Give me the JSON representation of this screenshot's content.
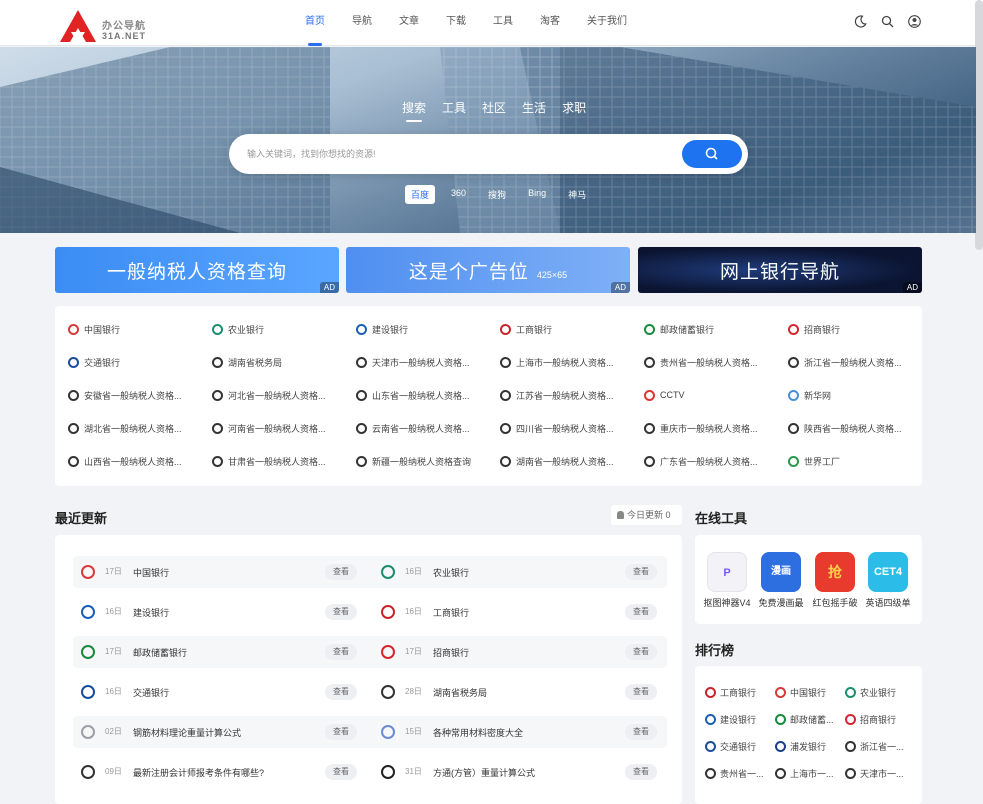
{
  "logo": {
    "name": "办公导航",
    "domain": "31A.NET"
  },
  "nav": {
    "items": [
      {
        "label": "首页",
        "active": true
      },
      {
        "label": "导航",
        "active": false
      },
      {
        "label": "文章",
        "active": false
      },
      {
        "label": "下载",
        "active": false
      },
      {
        "label": "工具",
        "active": false
      },
      {
        "label": "淘客",
        "active": false
      },
      {
        "label": "关于我们",
        "active": false
      }
    ],
    "icons": [
      "moon-icon",
      "search-icon",
      "user-icon"
    ]
  },
  "search": {
    "tabs": [
      "搜索",
      "工具",
      "社区",
      "生活",
      "求职"
    ],
    "active_tab": "搜索",
    "placeholder": "输入关键词，找到你想找的资源!",
    "engines": [
      "百度",
      "360",
      "搜狗",
      "Bing",
      "神马"
    ],
    "active_engine": "百度"
  },
  "ads": [
    {
      "title": "一般纳税人资格查询",
      "sub": "",
      "tag": "AD",
      "color": "#3d8ff5"
    },
    {
      "title": "这是个广告位",
      "sub": "425×65",
      "tag": "AD",
      "color": "#5b97f2"
    },
    {
      "title": "网上银行导航",
      "sub": "",
      "tag": "AD",
      "color": "#0b1430"
    }
  ],
  "links": [
    [
      "中国银行",
      "农业银行",
      "建设银行",
      "工商银行",
      "邮政储蓄银行",
      "招商银行"
    ],
    [
      "交通银行",
      "湖南省税务局",
      "天津市一般纳税人资格...",
      "上海市一般纳税人资格...",
      "贵州省一般纳税人资格...",
      "浙江省一般纳税人资格..."
    ],
    [
      "安徽省一般纳税人资格...",
      "河北省一般纳税人资格...",
      "山东省一般纳税人资格...",
      "江苏省一般纳税人资格...",
      "CCTV",
      "新华网"
    ],
    [
      "湖北省一般纳税人资格...",
      "河南省一般纳税人资格...",
      "云南省一般纳税人资格...",
      "四川省一般纳税人资格...",
      "重庆市一般纳税人资格...",
      "陕西省一般纳税人资格..."
    ],
    [
      "山西省一般纳税人资格...",
      "甘肃省一般纳税人资格...",
      "新疆一般纳税人资格查询",
      "湖南省一般纳税人资格...",
      "广东省一般纳税人资格...",
      "世界工厂"
    ]
  ],
  "recent": {
    "title": "最近更新",
    "today_label": "今日更新 0",
    "view_label": "查看",
    "rows": [
      [
        {
          "day": "17日",
          "name": "中国银行",
          "color": "#d63a3a"
        },
        {
          "day": "16日",
          "name": "农业银行",
          "color": "#1b8f6b"
        }
      ],
      [
        {
          "day": "16日",
          "name": "建设银行",
          "color": "#1d5fb4"
        },
        {
          "day": "16日",
          "name": "工商银行",
          "color": "#c8242b"
        }
      ],
      [
        {
          "day": "17日",
          "name": "邮政储蓄银行",
          "color": "#1a8a3d"
        },
        {
          "day": "17日",
          "name": "招商银行",
          "color": "#d4262e"
        }
      ],
      [
        {
          "day": "16日",
          "name": "交通银行",
          "color": "#1b4c9c"
        },
        {
          "day": "28日",
          "name": "湖南省税务局",
          "color": "#333333"
        }
      ],
      [
        {
          "day": "02日",
          "name": "钢筋材料理论重量计算公式",
          "color": "#9aa0a6"
        },
        {
          "day": "15日",
          "name": "各种常用材料密度大全",
          "color": "#6b8bd1"
        }
      ],
      [
        {
          "day": "09日",
          "name": "最新注册会计师报考条件有哪些?",
          "color": "#333333"
        },
        {
          "day": "31日",
          "name": "方通(方管）重量计算公式",
          "color": "#222222"
        }
      ]
    ]
  },
  "tools": {
    "title": "在线工具",
    "items": [
      {
        "name": "抠图神器V4",
        "glyph": "P",
        "color": "#f3f3f7"
      },
      {
        "name": "免费漫画最",
        "glyph": "漫画",
        "color": "#2d6fe0"
      },
      {
        "name": "红包摇手破",
        "glyph": "抢",
        "color": "#e93a2e"
      },
      {
        "name": "英语四级单",
        "glyph": "CET4",
        "color": "#2bbde8"
      }
    ]
  },
  "ranking": {
    "title": "排行榜",
    "rows": [
      [
        "工商银行",
        "中国银行",
        "农业银行"
      ],
      [
        "建设银行",
        "邮政储蓄...",
        "招商银行"
      ],
      [
        "交通银行",
        "浦发银行",
        "浙江省一..."
      ],
      [
        "贵州省一...",
        "上海市一...",
        "天津市一..."
      ]
    ]
  }
}
